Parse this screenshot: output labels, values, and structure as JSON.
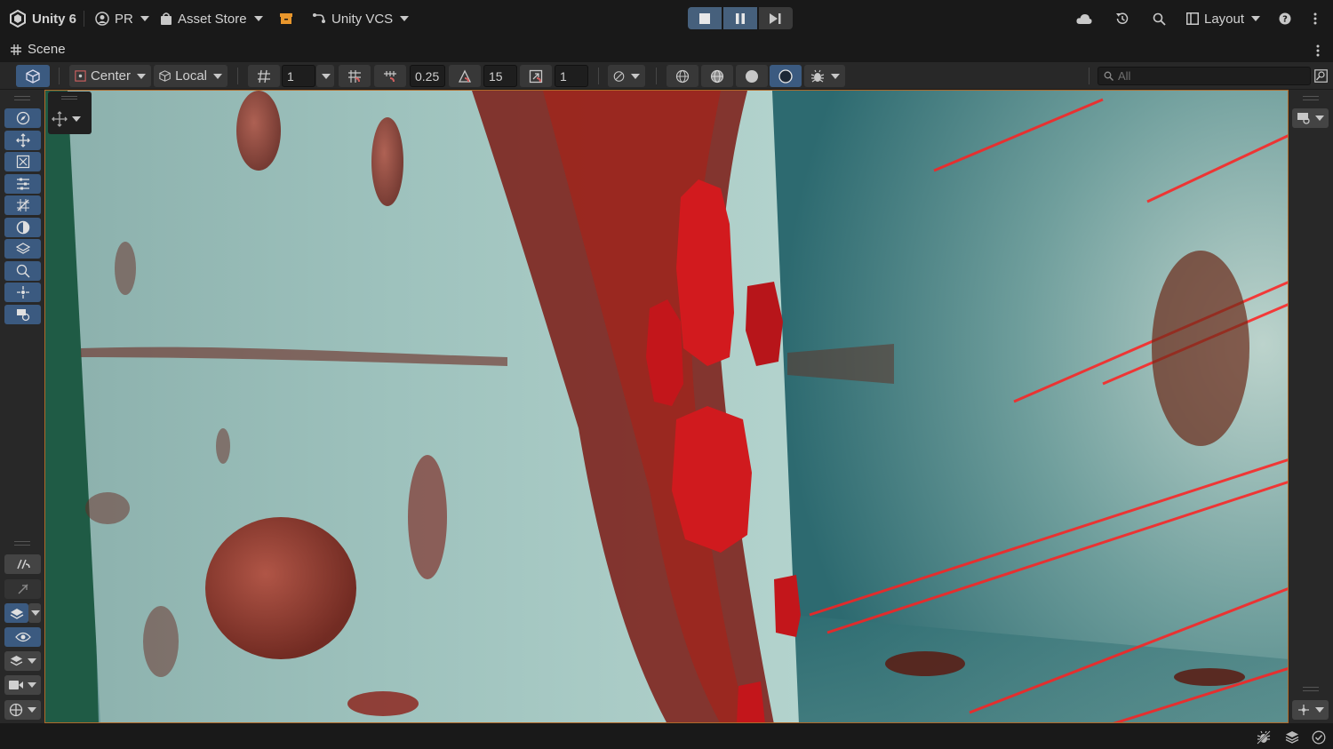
{
  "topbar": {
    "app_name": "Unity 6",
    "account": "PR",
    "asset_store": "Asset Store",
    "vcs": "Unity VCS",
    "layout": "Layout",
    "play_icons": [
      "stop-icon",
      "pause-icon",
      "step-icon"
    ],
    "right_icons": [
      "cloud-icon",
      "history-icon",
      "search-icon",
      "layout-icon",
      "help-icon",
      "more-icon"
    ]
  },
  "scene_tab": {
    "title": "Scene",
    "more_icon": "more-icon"
  },
  "scene_toolbar": {
    "pivot": "Center",
    "space": "Local",
    "grid_size": "1",
    "snap_value": "0.25",
    "rotate_snap": "15",
    "scale_snap": "1",
    "search_placeholder": "All"
  },
  "left_tools": [
    "view-tool-icon",
    "move-tool-icon",
    "rotate-tool-icon",
    "rect-tool-icon",
    "transform-tool-icon",
    "custom-tool-icon",
    "layers-tool-icon",
    "zoom-tool-icon",
    "pivot-tool-icon",
    "camera-tool-icon"
  ],
  "left_bottom_tools": [
    "snap-icon",
    "auto-snap-icon",
    "surface-snap-icon",
    "visibility-icon",
    "layer-icon",
    "camera-icon",
    "gizmo-icon"
  ],
  "colors": {
    "accent": "#46607c",
    "viewport_border": "#b06a2a",
    "blood": "#c0121a",
    "surface": "#8fb6b2"
  }
}
